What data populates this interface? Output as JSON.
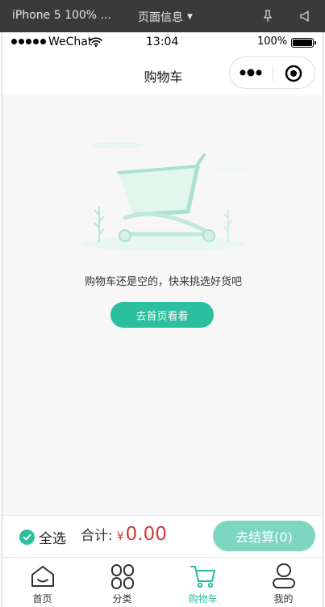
{
  "devtools": {
    "device_label": "iPhone 5 100% ...",
    "page_info_label": "页面信息"
  },
  "status_bar": {
    "carrier": "WeChat",
    "time": "13:04",
    "battery": "100%"
  },
  "nav": {
    "title": "购物车"
  },
  "empty_state": {
    "message": "购物车还是空的，快来挑选好货吧",
    "button_label": "去首页看看"
  },
  "checkout": {
    "select_all_label": "全选",
    "total_label": "合计:",
    "currency": "¥",
    "amount": "0.00",
    "pay_label": "去结算(0)"
  },
  "tabbar": {
    "items": [
      {
        "label": "首页",
        "icon": "home-icon"
      },
      {
        "label": "分类",
        "icon": "category-icon"
      },
      {
        "label": "购物车",
        "icon": "cart-icon",
        "active": true
      },
      {
        "label": "我的",
        "icon": "user-icon"
      }
    ]
  },
  "colors": {
    "accent": "#2bbf9e",
    "price": "#d03a3a",
    "pay_button": "#7dd6c1"
  }
}
